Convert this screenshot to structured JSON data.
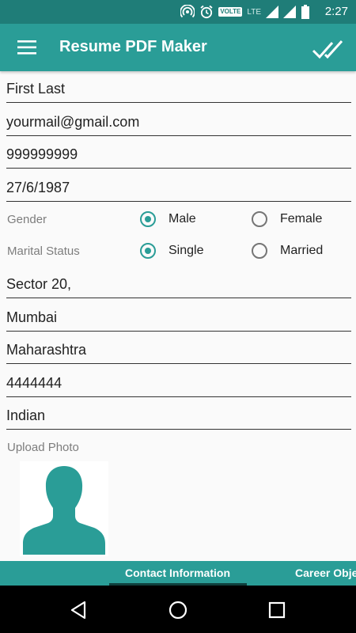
{
  "status_bar": {
    "time": "2:27",
    "volte": "VOLTE",
    "lte": "LTE",
    "icons": [
      "hotspot-icon",
      "alarm-icon",
      "volte-icon",
      "signal-icon",
      "signal-icon",
      "battery-icon"
    ]
  },
  "app_bar": {
    "title": "Resume PDF Maker",
    "menu_icon": "hamburger-menu-icon",
    "action_icon": "double-check-icon"
  },
  "form": {
    "name": "First Last",
    "email": "yourmail@gmail.com",
    "phone": "999999999",
    "dob": "27/6/1987",
    "gender": {
      "label": "Gender",
      "options": [
        "Male",
        "Female"
      ],
      "selected": "Male"
    },
    "marital_status": {
      "label": "Marital Status",
      "options": [
        "Single",
        "Married"
      ],
      "selected": "Single"
    },
    "address": "Sector 20,",
    "city": "Mumbai",
    "state": "Maharashtra",
    "pincode": "4444444",
    "nationality": "Indian",
    "upload_photo_label": "Upload Photo"
  },
  "tabs": {
    "items": [
      "Contact Information",
      "Career Obje"
    ],
    "active": "Contact Information"
  },
  "colors": {
    "status_bar": "#1f7d78",
    "primary": "#2a9d97",
    "accent": "#2a9d97"
  }
}
